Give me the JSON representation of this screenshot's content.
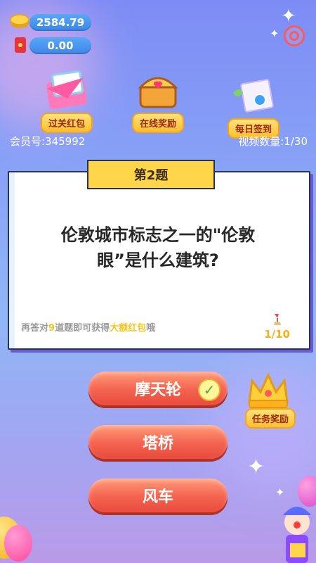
{
  "wallet": {
    "gold_amount": "2584.79",
    "cash_amount": "0.00"
  },
  "features": [
    {
      "label": "过关红包",
      "icon": "envelope-icon"
    },
    {
      "label": "在线奖励",
      "icon": "treasure-chest-icon"
    },
    {
      "label": "每日签到",
      "icon": "scroll-icon"
    }
  ],
  "member": {
    "id_text": "会员号:345992"
  },
  "video": {
    "count_text": "视频数量:1/30"
  },
  "question": {
    "number_label": "第2题",
    "text_line1": "伦敦城市标志之一的\"伦敦",
    "text_line2": "眼”是什么建筑?",
    "hint_prefix": "再答对",
    "hint_count": "9",
    "hint_middle": "道题即可获得",
    "hint_reward": "大额红包",
    "hint_suffix": "哦",
    "progress": "1/10"
  },
  "answers": [
    {
      "label": "摩天轮",
      "correct": true
    },
    {
      "label": "塔桥",
      "correct": false
    },
    {
      "label": "风车",
      "correct": false
    }
  ],
  "task": {
    "label": "任务奖励"
  },
  "colors": {
    "accent": "#f46350",
    "tag_bg": "#ffd54a",
    "card_border": "#273450"
  }
}
